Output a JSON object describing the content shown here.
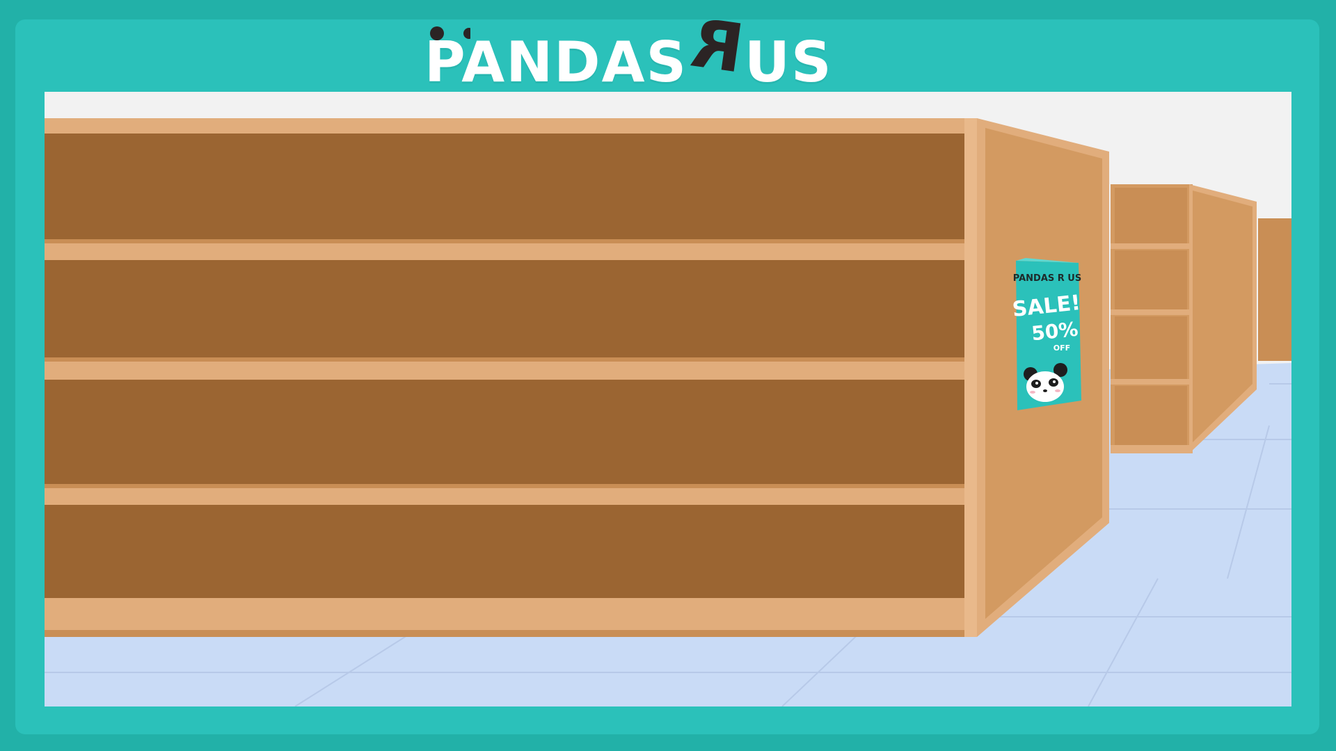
{
  "store": {
    "logo_left": "PANDAS",
    "logo_r": "R",
    "logo_right": "US"
  },
  "poster": {
    "brand": "PANDAS R US",
    "headline": "SALE!",
    "discount": "50%",
    "off": "OFF"
  },
  "colors": {
    "frame_dark": "#22b1a8",
    "frame_light": "#2bc1ba",
    "shelf_wood": "#9b6532",
    "shelf_trim": "#e1ad7c",
    "shelf_side": "#d39a61",
    "floor": "#c9dbf6",
    "wall": "#f2f2f2"
  }
}
